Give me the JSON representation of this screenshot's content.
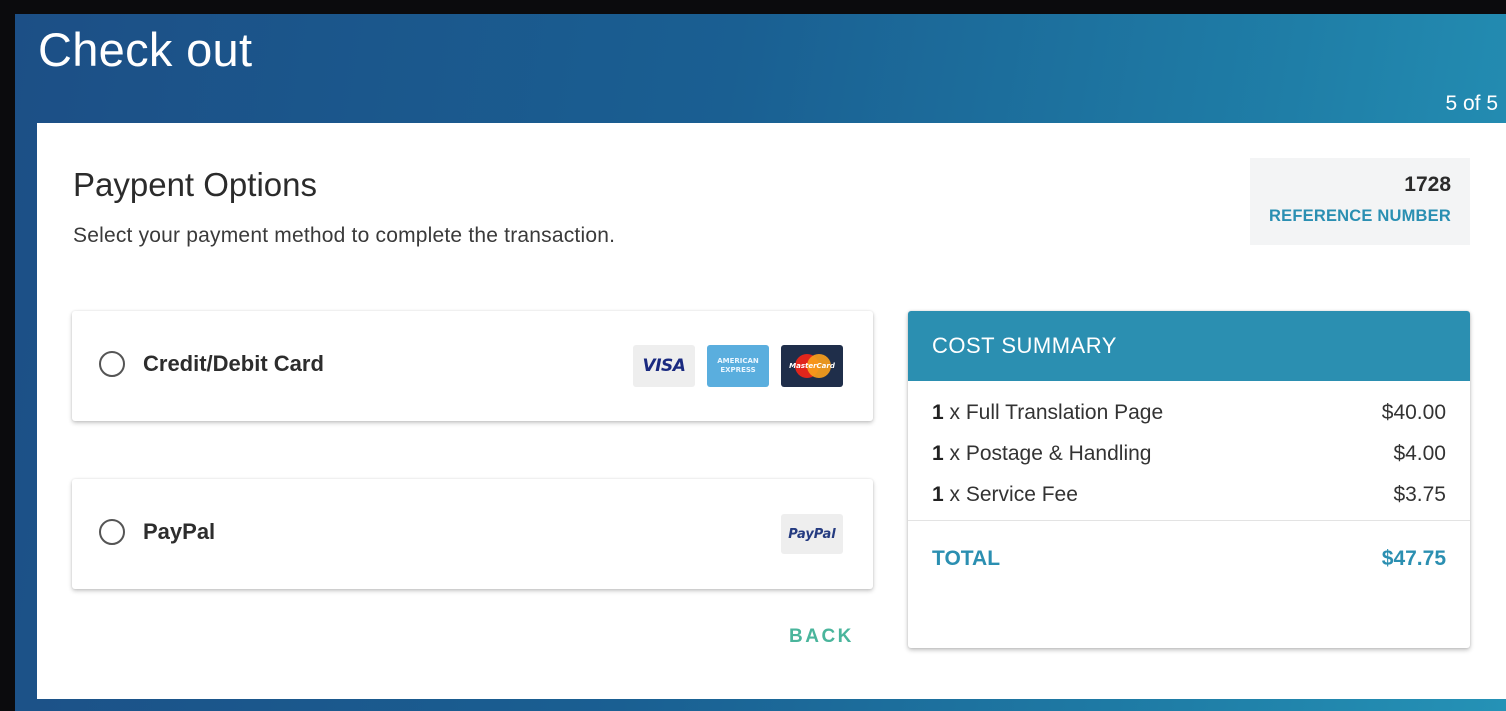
{
  "header": {
    "title": "Check out",
    "step": "5 of 5"
  },
  "page": {
    "title": "Paypent Options",
    "subtitle": "Select your payment method to complete the transaction."
  },
  "reference": {
    "number": "1728",
    "label": "REFERENCE NUMBER"
  },
  "payment_options": [
    {
      "label": "Credit/Debit Card",
      "logos": [
        "VISA",
        "AMERICAN EXPRESS",
        "MasterCard"
      ]
    },
    {
      "label": "PayPal",
      "logos": [
        "PayPal"
      ]
    }
  ],
  "back_label": "BACK",
  "summary": {
    "title": "COST SUMMARY",
    "items": [
      {
        "qty": "1",
        "desc": " x Full Translation Page",
        "price": "$40.00"
      },
      {
        "qty": "1",
        "desc": " x Postage & Handling",
        "price": "$4.00"
      },
      {
        "qty": "1",
        "desc": " x Service Fee",
        "price": "$3.75"
      }
    ],
    "total_label": "TOTAL",
    "total_value": "$47.75"
  },
  "colors": {
    "accent": "#2b8fb1",
    "back": "#4ab59c",
    "header_start": "#1c4f86",
    "header_end": "#2592b6"
  }
}
